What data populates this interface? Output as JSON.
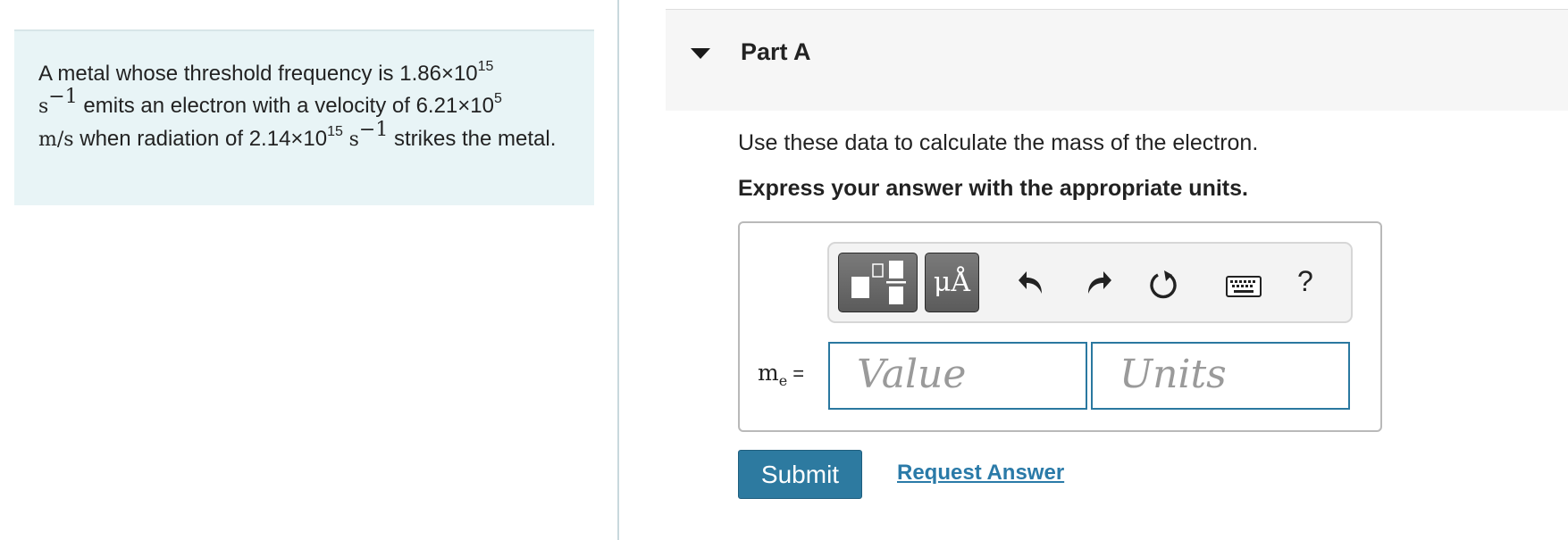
{
  "problem": {
    "text_1": "A metal whose threshold frequency is 1.86×10",
    "exp_1": "15",
    "unit_s": "s",
    "exp_neg1": "−1",
    "text_2": " emits an electron with a velocity of 6.21×10",
    "exp_2": "5",
    "unit_ms": "m/s",
    "text_3": " when radiation of 2.14×10",
    "exp_3": "15",
    "text_4": " strikes the metal."
  },
  "part": {
    "title": "Part A",
    "instruction": "Use these data to calculate the mass of the electron.",
    "units_hint": "Express your answer with the appropriate units."
  },
  "toolbar": {
    "units_symbol": "μÅ",
    "help": "?"
  },
  "answer": {
    "var": "m",
    "var_sub": "e",
    "equals": " =",
    "value_placeholder": "Value",
    "units_placeholder": "Units"
  },
  "actions": {
    "submit": "Submit",
    "request": "Request Answer"
  },
  "colors": {
    "accent": "#2d7aa0",
    "problem_bg": "#e8f4f6"
  }
}
